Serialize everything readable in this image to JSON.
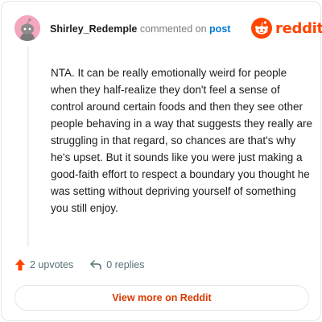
{
  "header": {
    "username": "Shirley_Redemple",
    "action_text": "commented on",
    "post_link": "post"
  },
  "brand": {
    "name": "reddit",
    "icon": "reddit-alien-icon",
    "color": "#ff4500"
  },
  "comment": {
    "body": "NTA. It can be really emotionally weird for people when they half-realize they don't feel a sense of control around certain foods and then they see other people behaving in a way that suggests they really are struggling in that regard, so chances are that's why he's upset. But it sounds like you were just making a good-faith effort to respect a boundary you thought he was setting without depriving yourself of something you still enjoy."
  },
  "actions": {
    "upvotes": {
      "icon": "upvote-arrow-icon",
      "label": "2 upvotes"
    },
    "replies": {
      "icon": "reply-arrow-icon",
      "label": "0 replies"
    }
  },
  "footer": {
    "button_label": "View more on Reddit"
  },
  "colors": {
    "accent": "#ff4500",
    "link": "#0079d3",
    "avatar_bg": "#f4a6bd"
  }
}
